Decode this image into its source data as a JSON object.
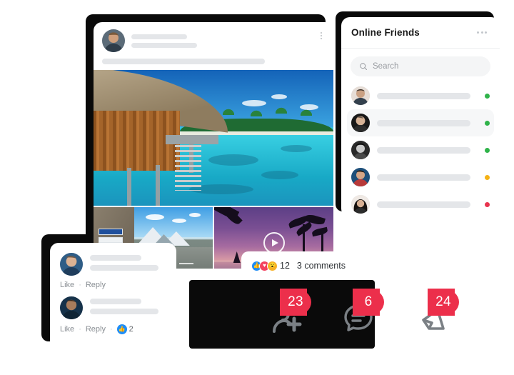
{
  "post": {
    "name": "social-post-card",
    "menu_icon": "kebab-vertical-icon",
    "media": [
      {
        "name": "overwater-bungalow-photo",
        "type": "image",
        "alt": "Tropical overwater bungalow on turquoise lagoon"
      },
      {
        "name": "cyclists-mountain-road-photo",
        "type": "image",
        "alt": "Two cyclists riding a mountain pass road"
      },
      {
        "name": "sunset-palms-video",
        "type": "video",
        "alt": "Purple sunset with palm trees and sailboat",
        "play_icon": "play-icon"
      }
    ]
  },
  "friends": {
    "title": "Online Friends",
    "menu_icon": "kebab-horizontal-icon",
    "search": {
      "icon": "search-icon",
      "placeholder": "Search",
      "value": ""
    },
    "items": [
      {
        "avatar": "friend-avatar-1",
        "status": "online",
        "status_color": "#2fb34a",
        "active": false
      },
      {
        "avatar": "friend-avatar-2",
        "status": "online",
        "status_color": "#2fb34a",
        "active": true
      },
      {
        "avatar": "friend-avatar-3",
        "status": "online",
        "status_color": "#2fb34a",
        "active": false
      },
      {
        "avatar": "friend-avatar-4",
        "status": "away",
        "status_color": "#f5b215",
        "active": false
      },
      {
        "avatar": "friend-avatar-5",
        "status": "busy",
        "status_color": "#e8344e",
        "active": false
      }
    ]
  },
  "comments": {
    "items": [
      {
        "avatar": "commenter-avatar-1",
        "like_label": "Like",
        "separator": "·",
        "reply_label": "Reply",
        "has_likes": false,
        "like_count": ""
      },
      {
        "avatar": "commenter-avatar-2",
        "like_label": "Like",
        "separator": "·",
        "reply_label": "Reply",
        "has_likes": true,
        "like_icon": "thumbs-up-icon",
        "like_count": "2"
      }
    ]
  },
  "reactions": {
    "icons": [
      {
        "name": "reaction-like-icon",
        "glyph": "👍",
        "color": "#1f8df5"
      },
      {
        "name": "reaction-love-icon",
        "glyph": "♥",
        "color": "#f3425f"
      },
      {
        "name": "reaction-wow-icon",
        "glyph": "😮",
        "color": "#f7b125"
      }
    ],
    "count": "12",
    "comments_label": "3 comments"
  },
  "nav_badges": [
    {
      "name": "friend-requests",
      "icon": "add-friend-icon",
      "count": "23"
    },
    {
      "name": "messages",
      "icon": "messenger-icon",
      "count": "6"
    },
    {
      "name": "notifications",
      "icon": "notifications-icon",
      "count": "24"
    }
  ],
  "colors": {
    "badge_red": "#ec2f4b",
    "accent_blue": "#1f8df5",
    "placeholder_grey": "#e4e6e9"
  }
}
